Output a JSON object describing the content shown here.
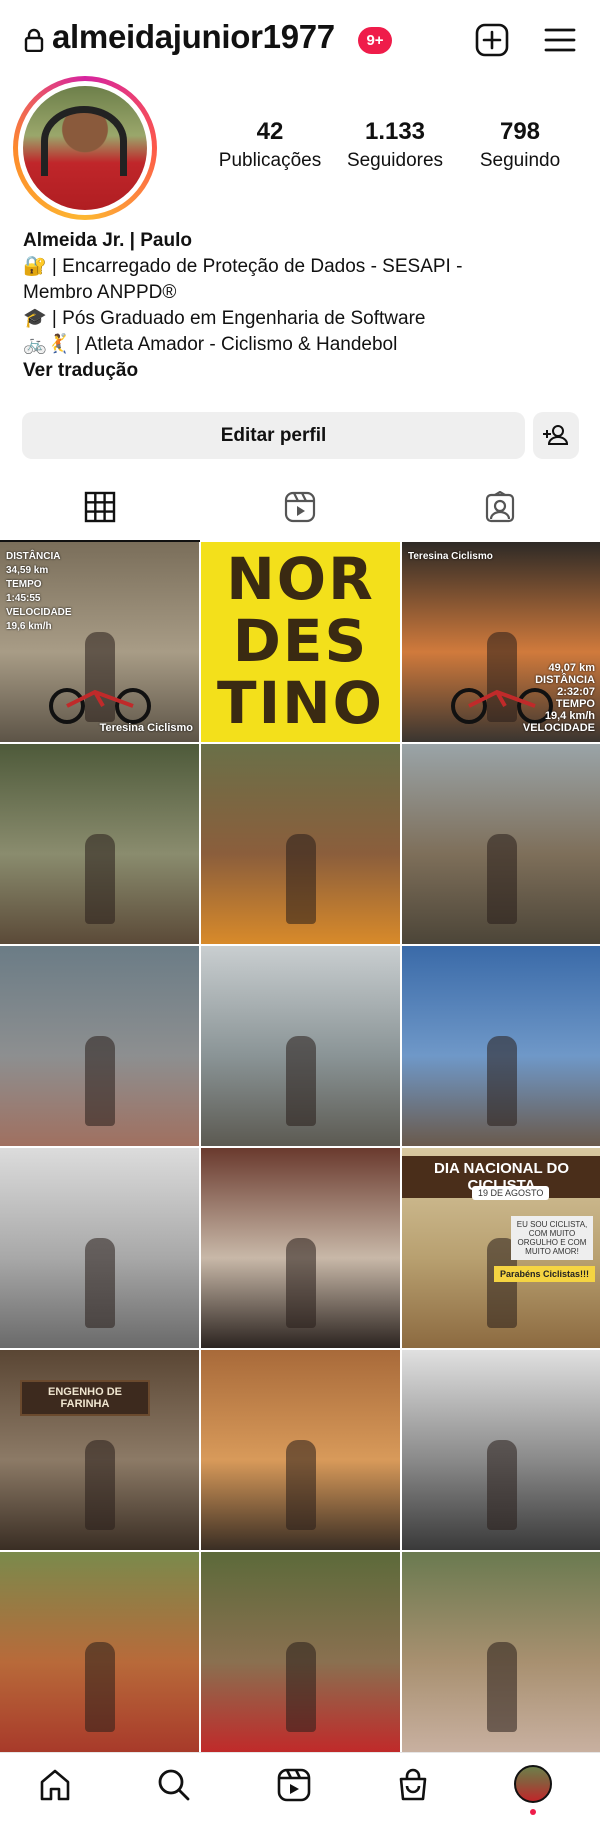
{
  "header": {
    "username": "almeidajunior1977",
    "notification_badge": "9+",
    "icons": [
      "lock-icon",
      "new-post-icon",
      "menu-icon"
    ]
  },
  "profile": {
    "stats": [
      {
        "value": "42",
        "label": "Publicações"
      },
      {
        "value": "1.133",
        "label": "Seguidores"
      },
      {
        "value": "798",
        "label": "Seguindo"
      }
    ],
    "bio": {
      "name": "Almeida Jr. | Paulo",
      "line1": "🔐 | Encarregado de Proteção de Dados - SESAPI -",
      "line2": "Membro ANPPD®",
      "line3": "🎓 | Pós Graduado em Engenharia de Software",
      "line4": "🚲🤾 | Atleta Amador - Ciclismo & Handebol",
      "translate": "Ver tradução"
    },
    "edit_button": "Editar perfil"
  },
  "tabs": [
    "grid-tab",
    "reels-tab",
    "tagged-tab"
  ],
  "posts": [
    {
      "kind": "ride",
      "overlay_top": "DISTÂNCIA\n34,59 km\nTEMPO\n1:45:55\nVELOCIDADE\n19,6 km/h",
      "overlay_bottom": "Teresina Ciclismo",
      "colors": [
        "#7a6e5a",
        "#a89c86",
        "#5d5447"
      ]
    },
    {
      "kind": "nordestino",
      "text": "NOR\nDES\nTINO"
    },
    {
      "kind": "ride",
      "overlay_top": "Teresina Ciclismo",
      "overlay_bottom": "49,07 km\nDISTÂNCIA\n2:32:07\nTEMPO\n19,4 km/h\nVELOCIDADE",
      "colors": [
        "#2e2a26",
        "#d07a3c",
        "#3a3530"
      ]
    },
    {
      "kind": "photo",
      "colors": [
        "#4e5a3a",
        "#8a8c6e",
        "#5b4a38"
      ]
    },
    {
      "kind": "photo",
      "colors": [
        "#6a7048",
        "#8b5e3c",
        "#d88a2a"
      ]
    },
    {
      "kind": "photo",
      "colors": [
        "#9aa4a8",
        "#7e6f5a",
        "#4c4538"
      ]
    },
    {
      "kind": "photo",
      "colors": [
        "#6b7c86",
        "#8d8f90",
        "#a07060"
      ]
    },
    {
      "kind": "photo",
      "colors": [
        "#c9ced0",
        "#8a9496",
        "#5c5a52"
      ]
    },
    {
      "kind": "photo",
      "colors": [
        "#3a6aa8",
        "#6f98c8",
        "#6a5a4c"
      ]
    },
    {
      "kind": "photo",
      "colors": [
        "#dcdcdc",
        "#a8a8a8",
        "#6a6a6a"
      ]
    },
    {
      "kind": "photo",
      "colors": [
        "#6a3a2e",
        "#c8b8a8",
        "#2c2420"
      ]
    },
    {
      "kind": "dia",
      "title": "DIA NACIONAL DO CICLISTA",
      "tag": "19 DE AGOSTO",
      "box": "EU SOU CICLISTA, COM MUITO ORGULHO E COM MUITO AMOR!",
      "par": "Parabéns Ciclistas!!!",
      "colors": [
        "#d8c8a0",
        "#b8a070",
        "#8c6a40"
      ]
    },
    {
      "kind": "engenho",
      "title": "ENGENHO DE FARINHA",
      "colors": [
        "#5a4634",
        "#8c7a66",
        "#3a2e24"
      ]
    },
    {
      "kind": "photo",
      "colors": [
        "#a86a3a",
        "#d89a5a",
        "#3a2e24"
      ]
    },
    {
      "kind": "photo",
      "colors": [
        "#e0e0e0",
        "#8a8a8a",
        "#3a3a3a"
      ]
    },
    {
      "kind": "photo",
      "colors": [
        "#7a8a4c",
        "#b86a3a",
        "#a83a2a"
      ]
    },
    {
      "kind": "photo",
      "colors": [
        "#5c6a3a",
        "#8a7050",
        "#c02a2a"
      ]
    },
    {
      "kind": "photo",
      "colors": [
        "#6a7a50",
        "#a89070",
        "#c8b0a0"
      ]
    }
  ],
  "bottom_nav": [
    "home-icon",
    "search-icon",
    "reels-icon",
    "shop-icon",
    "profile-avatar"
  ]
}
